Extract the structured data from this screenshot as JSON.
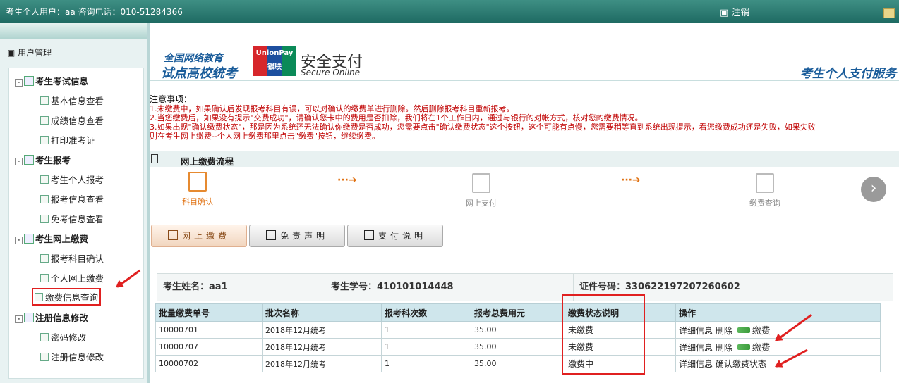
{
  "topbar": {
    "user_text": "考生个人用户：aa 咨询电话：010-51284366",
    "logout": "注销"
  },
  "sidebar": {
    "title": "用户管理",
    "groups": [
      {
        "label": "考生考试信息",
        "items": [
          "基本信息查看",
          "成绩信息查看",
          "打印准考证"
        ]
      },
      {
        "label": "考生报考",
        "items": [
          "考生个人报考",
          "报考信息查看",
          "免考信息查看"
        ]
      },
      {
        "label": "考生网上缴费",
        "items": [
          "报考科目确认",
          "个人网上缴费",
          "缴费信息查询"
        ]
      },
      {
        "label": "注册信息修改",
        "items": [
          "密码修改",
          "注册信息修改"
        ]
      }
    ]
  },
  "banner": {
    "line1": "全国网络教育",
    "line2": "试点高校统考",
    "unionpay": "UnionPay 银联",
    "secure_cn": "安全支付",
    "secure_en": "Secure Online",
    "right": "考生个人支付服务"
  },
  "notice": {
    "title": "注意事项：",
    "lines": [
      "1.未缴费中，如果确认后发现报考科目有误，可以对确认的缴费单进行删除。然后删除报考科目重新报考。",
      "2.当您缴费后，如果没有提示\"交费成功\"，请确认您卡中的费用是否扣除，我们将在1个工作日内，通过与银行的对帐方式，核对您的缴费情况。",
      "3.如果出现\"确认缴费状态\"，那是因为系统还无法确认你缴费是否成功，您需要点击\"确认缴费状态\"这个按钮，这个可能有点慢，您需要稍等直到系统出现提示，看您缴费成功还是失败，如果失败",
      "则在考生网上缴费--个人网上缴费那里点击\"缴费\"按钮，继续缴费。"
    ]
  },
  "flow": {
    "title": "网上缴费流程",
    "steps": [
      "科目确认",
      "网上支付",
      "缴费查询"
    ],
    "next_icon": "chevron-right-icon"
  },
  "tabs": [
    "网上缴费",
    "免责声明",
    "支付说明"
  ],
  "student": {
    "name": "考生姓名：aa1",
    "id": "考生学号：410101014448",
    "cert": "证件号码：330622197207260602"
  },
  "table": {
    "headers": [
      "批量缴费单号",
      "批次名称",
      "报考科次数",
      "报考总费用元",
      "缴费状态说明",
      "操作"
    ],
    "rows": [
      {
        "no": "10000701",
        "batch": "2018年12月统考",
        "count": "1",
        "fee": "35.00",
        "status": "未缴费",
        "detail": "详细信息",
        "del": "删除",
        "action": "缴费"
      },
      {
        "no": "10000707",
        "batch": "2018年12月统考",
        "count": "1",
        "fee": "35.00",
        "status": "未缴费",
        "detail": "详细信息",
        "del": "删除",
        "action": "缴费"
      },
      {
        "no": "10000702",
        "batch": "2018年12月统考",
        "count": "1",
        "fee": "35.00",
        "status": "缴费中",
        "detail": "详细信息",
        "del": "",
        "action": "确认缴费状态"
      }
    ]
  },
  "colors": {
    "topbar": "#2a7a70",
    "highlight": "#e02020",
    "accent": "#e07010"
  }
}
